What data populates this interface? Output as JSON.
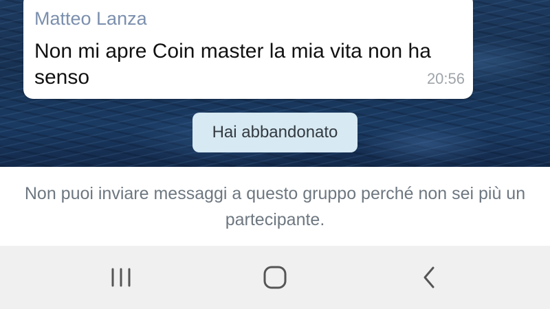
{
  "chat": {
    "message": {
      "sender": "Matteo Lanza",
      "text": "Non mi apre Coin master la mia vita non ha senso",
      "time": "20:56"
    },
    "service_message": "Hai abbandonato"
  },
  "notice": {
    "text": "Non puoi inviare messaggi a questo gruppo perché non sei più un partecipante."
  },
  "nav_bar": {
    "buttons": [
      "recent-apps-icon",
      "home-icon",
      "back-icon"
    ]
  },
  "colors": {
    "sender_name": "#7b8fad",
    "service_pill_bg": "#d7e9f2",
    "notice_text": "#6d7780",
    "nav_bar_bg": "#f0f0f0"
  }
}
